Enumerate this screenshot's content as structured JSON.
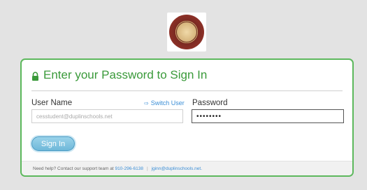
{
  "logo": {
    "icon": "school-district-seal-logo"
  },
  "card": {
    "title": "Enter your Password to Sign In",
    "lock_icon": "lock-icon"
  },
  "form": {
    "username_label": "User Name",
    "switch_user_label": "Switch User",
    "username_value": "cesstudent@duplinschools.net",
    "password_label": "Password",
    "password_value": "••••••••",
    "signin_label": "Sign In"
  },
  "footer": {
    "help_text": "Need help? Contact our support team at",
    "phone": "910-296-6138",
    "separator": "|",
    "email": "jginn@duplinschools.net."
  },
  "colors": {
    "accent_green": "#5cb85c",
    "title_green": "#3a9a3a",
    "link_blue": "#3b8ed6",
    "button_blue": "#6fb8d9",
    "background": "#e3e3e3"
  }
}
